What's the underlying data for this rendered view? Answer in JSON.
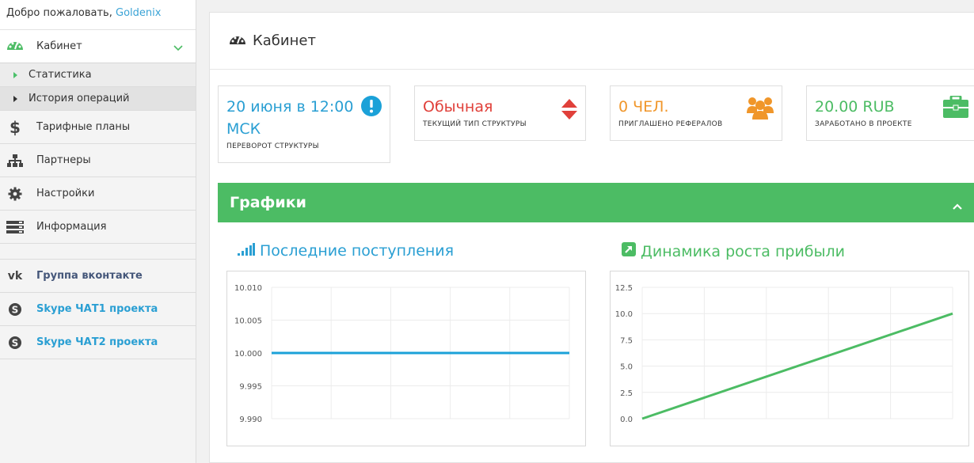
{
  "welcome": {
    "text": "Добро пожаловать, ",
    "user": "Goldenix"
  },
  "sidebar": {
    "main": {
      "label": "Кабинет"
    },
    "sub": [
      {
        "label": "Статистика"
      },
      {
        "label": "История операций"
      }
    ],
    "items": [
      {
        "label": "Тарифные планы",
        "icon": "dollar-icon"
      },
      {
        "label": "Партнеры",
        "icon": "sitemap-icon"
      },
      {
        "label": "Настройки",
        "icon": "gear-icon"
      },
      {
        "label": "Информация",
        "icon": "server-icon"
      }
    ],
    "social": [
      {
        "label": "Группа вконтакте",
        "icon": "vk-icon"
      },
      {
        "label": "Skype ЧАТ1 проекта",
        "icon": "skype-icon"
      },
      {
        "label": "Skype ЧАТ2 проекта",
        "icon": "skype-icon"
      }
    ]
  },
  "page": {
    "title": "Кабинет"
  },
  "stats": [
    {
      "value": "20 июня в 12:00 МСК",
      "label": "ПЕРЕВОРОТ СТРУКТУРЫ",
      "color": "#2a9fd3",
      "icon": "exclamation-circle-icon"
    },
    {
      "value": "Обычная",
      "label": "ТЕКУЩИЙ ТИП СТРУКТУРЫ",
      "color": "#e0403a",
      "icon": "sort-icon"
    },
    {
      "value": "0 ЧЕЛ.",
      "label": "ПРИГЛАШЕНО РЕФЕРАЛОВ",
      "color": "#f0962a",
      "icon": "users-icon"
    },
    {
      "value": "20.00 RUB",
      "label": "ЗАРАБОТАНО В ПРОЕКТЕ",
      "color": "#4cbc64",
      "icon": "briefcase-icon"
    }
  ],
  "panel": {
    "title": "Графики"
  },
  "colors": {
    "accent_green": "#4cbc64",
    "accent_blue": "#2a9fd3"
  },
  "chart_data": [
    {
      "type": "line",
      "title": "Последние поступления",
      "ylim": [
        9.99,
        10.01
      ],
      "yticks": [
        "10.010",
        "10.005",
        "10.000",
        "9.995",
        "9.990"
      ],
      "x": [
        0,
        1
      ],
      "series": [
        {
          "values": [
            10.0,
            10.0
          ],
          "color": "#1ba1d8"
        }
      ],
      "grid": true
    },
    {
      "type": "line",
      "title": "Динамика роста прибыли",
      "ylim": [
        0,
        12.5
      ],
      "yticks": [
        "12.5",
        "10.0",
        "7.5",
        "5.0",
        "2.5",
        "0.0"
      ],
      "x": [
        0,
        1
      ],
      "series": [
        {
          "values": [
            0,
            10
          ],
          "color": "#4cbc64"
        }
      ],
      "grid": true
    }
  ]
}
